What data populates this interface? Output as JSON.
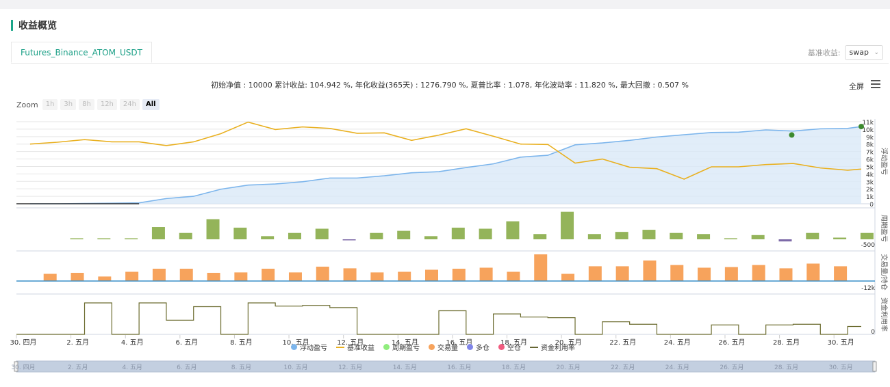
{
  "section": {
    "title": "收益概览"
  },
  "tabs": [
    {
      "label": "Futures_Binance_ATOM_USDT",
      "active": true
    }
  ],
  "benchmark": {
    "label": "基准收益:",
    "value": "swap"
  },
  "summary": "初始净值 : 10000 累计收益: 104.942 %, 年化收益(365天) : 1276.790 %, 夏普比率 : 1.078, 年化波动率 : 11.820 %, 最大回撤 : 0.507 %",
  "toolbar": {
    "fullscreen_label": "全屏"
  },
  "zoom": {
    "label": "Zoom",
    "buttons": [
      "1h",
      "3h",
      "8h",
      "12h",
      "24h",
      "All"
    ],
    "active": "All"
  },
  "legend": [
    {
      "label": "浮动盈亏",
      "color": "#7cb5ec",
      "kind": "dot"
    },
    {
      "label": "基准收益",
      "color": "#e9b020",
      "kind": "line"
    },
    {
      "label": "周期盈亏",
      "color": "#90ed7d",
      "kind": "dot"
    },
    {
      "label": "交易量",
      "color": "#f7a35c",
      "kind": "dot"
    },
    {
      "label": "多仓",
      "color": "#8085e9",
      "kind": "dot"
    },
    {
      "label": "空仓",
      "color": "#f15c80",
      "kind": "dot"
    },
    {
      "label": "资金利用率",
      "color": "#666633",
      "kind": "line"
    }
  ],
  "colors": {
    "accent": "#1aa589",
    "pnl_area": "#d9e8f8",
    "pnl_line": "#7cb5ec",
    "benchmark": "#e9b020",
    "bars_green": "#94b45a",
    "bars_purple": "#7d6aa8",
    "volume": "#f7a35c",
    "utilization": "#6b6b2e"
  },
  "chart_data": {
    "type": "line",
    "x_labels": [
      "30. 四月",
      "2. 五月",
      "4. 五月",
      "6. 五月",
      "8. 五月",
      "10. 五月",
      "12. 五月",
      "14. 五月",
      "16. 五月",
      "18. 五月",
      "20. 五月",
      "22. 五月",
      "24. 五月",
      "26. 五月",
      "28. 五月",
      "30. 五月"
    ],
    "x_range": [
      0,
      31
    ],
    "panels": [
      {
        "id": "pnl",
        "axis_title": "浮动盈亏",
        "y_ticks": [
          "11k",
          "10k",
          "9k",
          "8k",
          "7k",
          "6k",
          "5k",
          "4k",
          "3k",
          "2k",
          "1k",
          "0"
        ],
        "ylim": [
          0,
          11000
        ],
        "series": [
          {
            "name": "浮动盈亏",
            "type": "area",
            "x": [
              0.5,
              1.5,
              2.5,
              3.5,
              4.5,
              5.5,
              6.5,
              7.5,
              8.5,
              9.5,
              10.5,
              11.5,
              12.5,
              13.5,
              14.5,
              15.5,
              16.5,
              17.5,
              18.5,
              19.5,
              20.5,
              21.5,
              22.5,
              23.5,
              24.5,
              25.5,
              26.5,
              27.5,
              28.5,
              29.5,
              30.5,
              31
            ],
            "values": [
              0,
              0,
              40,
              70,
              120,
              700,
              1000,
              1950,
              2500,
              2650,
              2950,
              3450,
              3450,
              3750,
              4150,
              4300,
              4850,
              5350,
              6250,
              6500,
              7900,
              8150,
              8500,
              8950,
              9250,
              9550,
              9600,
              9900,
              9750,
              10050,
              10100,
              10350
            ]
          },
          {
            "name": "基准收益",
            "type": "line",
            "x": [
              0.5,
              1.5,
              2.5,
              3.5,
              4.5,
              5.5,
              6.5,
              7.5,
              8.5,
              9.5,
              10.5,
              11.5,
              12.5,
              13.5,
              14.5,
              15.5,
              16.5,
              17.5,
              18.5,
              19.5,
              20.5,
              21.5,
              22.5,
              23.5,
              24.5,
              25.5,
              26.5,
              27.5,
              28.5,
              29.5,
              30.5,
              31
            ],
            "values": [
              8000,
              8250,
              8600,
              8300,
              8300,
              7800,
              8300,
              9400,
              10950,
              9950,
              10300,
              10100,
              9450,
              9500,
              8500,
              9200,
              10050,
              9050,
              8000,
              7950,
              5450,
              6000,
              4900,
              4700,
              3300,
              4950,
              4950,
              5250,
              5400,
              4800,
              4500,
              4650
            ]
          }
        ]
      },
      {
        "id": "period_pnl",
        "axis_title": "周期盈亏",
        "y_ticks": [
          "-500"
        ],
        "series": [
          {
            "name": "周期盈亏",
            "type": "bar",
            "x": [
              2.5,
              3.5,
              4.5,
              5.5,
              6.5,
              7.5,
              8.5,
              9.5,
              10.5,
              11.5,
              12.5,
              13.5,
              14.5,
              15.5,
              16.5,
              17.5,
              18.5,
              19.5,
              20.5,
              21.5,
              22.5,
              23.5,
              24.5,
              25.5,
              26.5,
              27.5,
              28.5,
              29.5,
              30.5,
              31.5
            ],
            "values": [
              40,
              40,
              30,
              580,
              300,
              950,
              550,
              150,
              300,
              500,
              -30,
              300,
              400,
              150,
              550,
              500,
              850,
              250,
              1300,
              250,
              350,
              450,
              300,
              250,
              50,
              200,
              -100,
              300,
              80,
              300
            ]
          }
        ]
      },
      {
        "id": "volume",
        "axis_title": "交易量/持仓",
        "y_ticks": [
          "-12k"
        ],
        "series": [
          {
            "name": "交易量",
            "type": "bar",
            "x": [
              1.5,
              2.5,
              3.5,
              4.5,
              5.5,
              6.5,
              7.5,
              8.5,
              9.5,
              10.5,
              11.5,
              12.5,
              13.5,
              14.5,
              15.5,
              16.5,
              17.5,
              18.5,
              19.5,
              20.5,
              21.5,
              22.5,
              23.5,
              24.5,
              25.5,
              26.5,
              27.5,
              28.5,
              29.5,
              30.5
            ],
            "values": [
              35,
              40,
              22,
              45,
              60,
              60,
              40,
              42,
              60,
              42,
              70,
              62,
              42,
              45,
              55,
              60,
              65,
              45,
              130,
              35,
              72,
              72,
              100,
              78,
              65,
              68,
              78,
              62,
              85,
              72
            ]
          }
        ]
      },
      {
        "id": "utilization",
        "axis_title": "资金利用率",
        "y_ticks": [
          "0"
        ],
        "series": [
          {
            "name": "资金利用率",
            "type": "step",
            "x": [
              0,
              2.5,
              3.5,
              4.5,
              5.5,
              6.5,
              7.5,
              8.5,
              9.5,
              10.5,
              11.5,
              12.5,
              13.5,
              14.5,
              15.5,
              16.5,
              17.5,
              18.5,
              19.5,
              20.5,
              21.5,
              22.5,
              23.5,
              24.5,
              25.5,
              26.5,
              27.5,
              28.5,
              29.5,
              30.5,
              31
            ],
            "values": [
              0,
              100,
              0,
              100,
              45,
              88,
              0,
              100,
              90,
              92,
              85,
              0,
              0,
              0,
              75,
              0,
              65,
              55,
              53,
              0,
              40,
              32,
              0,
              0,
              30,
              0,
              30,
              32,
              0,
              25,
              25
            ]
          }
        ]
      }
    ]
  }
}
